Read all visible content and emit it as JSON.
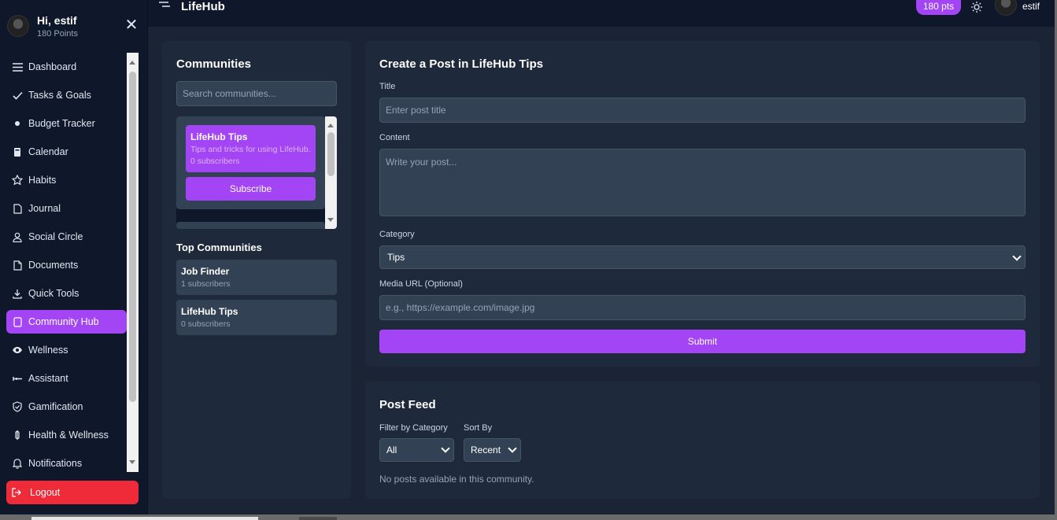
{
  "sidebar": {
    "greeting": "Hi, estif",
    "points": "180 Points",
    "items": [
      {
        "label": "Dashboard",
        "icon": "menu-icon"
      },
      {
        "label": "Tasks & Goals",
        "icon": "check-icon"
      },
      {
        "label": "Budget Tracker",
        "icon": "dot-icon"
      },
      {
        "label": "Calendar",
        "icon": "calendar-icon"
      },
      {
        "label": "Habits",
        "icon": "star-icon"
      },
      {
        "label": "Journal",
        "icon": "file-icon"
      },
      {
        "label": "Social Circle",
        "icon": "user-icon"
      },
      {
        "label": "Documents",
        "icon": "document-icon"
      },
      {
        "label": "Quick Tools",
        "icon": "download-icon"
      },
      {
        "label": "Community Hub",
        "icon": "square-icon",
        "active": true
      },
      {
        "label": "Wellness",
        "icon": "eye-icon"
      },
      {
        "label": "Assistant",
        "icon": "assistant-icon"
      },
      {
        "label": "Gamification",
        "icon": "shield-icon"
      },
      {
        "label": "Health & Wellness",
        "icon": "pulse-icon"
      },
      {
        "label": "Notifications",
        "icon": "bell-icon"
      }
    ],
    "logout": "Logout"
  },
  "topbar": {
    "brand": "LifeHub",
    "points_badge": "180 pts",
    "username": "estif"
  },
  "communities": {
    "title": "Communities",
    "search_placeholder": "Search communities...",
    "list": [
      {
        "name": "LifeHub Tips",
        "description": "Tips and tricks for using LifeHub.",
        "subscribers": "0 subscribers",
        "action": "Subscribe"
      }
    ],
    "top_title": "Top Communities",
    "top": [
      {
        "name": "Job Finder",
        "subscribers": "1 subscribers"
      },
      {
        "name": "LifeHub Tips",
        "subscribers": "0 subscribers"
      }
    ]
  },
  "create_post": {
    "title": "Create a Post in LifeHub Tips",
    "title_label": "Title",
    "title_placeholder": "Enter post title",
    "content_label": "Content",
    "content_placeholder": "Write your post...",
    "category_label": "Category",
    "category_value": "Tips",
    "media_label": "Media URL (Optional)",
    "media_placeholder": "e.g., https://example.com/image.jpg",
    "submit": "Submit"
  },
  "feed": {
    "title": "Post Feed",
    "filter_label": "Filter by Category",
    "filter_value": "All",
    "sort_label": "Sort By",
    "sort_value": "Recent",
    "empty": "No posts available in this community."
  },
  "colors": {
    "accent": "#a445f5",
    "danger": "#ef2b3a",
    "panel": "#1e293b",
    "background": "#0f172a"
  }
}
